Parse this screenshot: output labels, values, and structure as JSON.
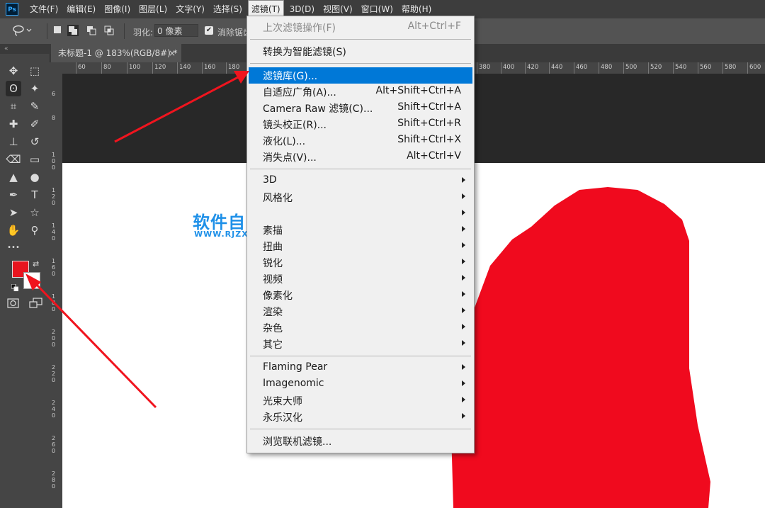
{
  "app": {
    "logo_text": "Ps"
  },
  "menubar": {
    "items": [
      {
        "label": "文件(F)"
      },
      {
        "label": "编辑(E)"
      },
      {
        "label": "图像(I)"
      },
      {
        "label": "图层(L)"
      },
      {
        "label": "文字(Y)"
      },
      {
        "label": "选择(S)"
      },
      {
        "label": "滤镜(T)"
      },
      {
        "label": "3D(D)"
      },
      {
        "label": "视图(V)"
      },
      {
        "label": "窗口(W)"
      },
      {
        "label": "帮助(H)"
      }
    ],
    "active_index": 6
  },
  "options": {
    "feather_label": "羽化:",
    "feather_value": "0 像素",
    "antialias_label": "消除锯齿",
    "antialias_checked": "✔"
  },
  "document_tab": {
    "title": "未标题-1 @ 183%(RGB/8#) *",
    "close": "×"
  },
  "ruler_top_labels": [
    "60",
    "80",
    "100",
    "120",
    "140",
    "160",
    "180",
    "380",
    "400",
    "420",
    "440",
    "460",
    "480",
    "500",
    "520",
    "540",
    "560",
    "580",
    "600"
  ],
  "ruler_left_labels": [
    "6",
    "8",
    "1 0 0",
    "1 2 0",
    "1 4 0",
    "1 6 0",
    "1 8 0",
    "2 0 0",
    "2 2 0",
    "2 4 0",
    "2 6 0",
    "2 8 0"
  ],
  "toolbar": {
    "handle": "«",
    "tools": [
      {
        "name": "move-tool",
        "glyph": "✥"
      },
      {
        "name": "marquee-tool",
        "glyph": "⬚"
      },
      {
        "name": "lasso-tool",
        "glyph": "ʘ"
      },
      {
        "name": "magic-wand-tool",
        "glyph": "✦"
      },
      {
        "name": "crop-tool",
        "glyph": "⌗"
      },
      {
        "name": "eyedropper-tool",
        "glyph": "✎"
      },
      {
        "name": "healing-brush-tool",
        "glyph": "✚"
      },
      {
        "name": "brush-tool",
        "glyph": "✐"
      },
      {
        "name": "stamp-tool",
        "glyph": "⊥"
      },
      {
        "name": "history-brush-tool",
        "glyph": "↺"
      },
      {
        "name": "eraser-tool",
        "glyph": "⌫"
      },
      {
        "name": "gradient-tool",
        "glyph": "▭"
      },
      {
        "name": "blur-tool",
        "glyph": "▲"
      },
      {
        "name": "dodge-tool",
        "glyph": "●"
      },
      {
        "name": "pen-tool",
        "glyph": "✒"
      },
      {
        "name": "type-tool",
        "glyph": "T"
      },
      {
        "name": "path-selection-tool",
        "glyph": "➤"
      },
      {
        "name": "shape-tool",
        "glyph": "☆"
      },
      {
        "name": "hand-tool",
        "glyph": "✋"
      },
      {
        "name": "zoom-tool",
        "glyph": "⚲"
      },
      {
        "name": "more-tools",
        "glyph": "•••"
      }
    ]
  },
  "watermark": {
    "title": "软件自学网",
    "url": "WWW.RJZXW.COM"
  },
  "filter_menu": {
    "items": [
      {
        "label": "上次滤镜操作(F)",
        "shortcut": "Alt+Ctrl+F",
        "disabled": true
      },
      {
        "sep": true
      },
      {
        "label": "转换为智能滤镜(S)",
        "shortcut": ""
      },
      {
        "sep": true
      },
      {
        "label": "滤镜库(G)...",
        "shortcut": "",
        "highlighted": true
      },
      {
        "label": "自适应广角(A)...",
        "shortcut": "Alt+Shift+Ctrl+A"
      },
      {
        "label": "Camera Raw 滤镜(C)...",
        "shortcut": "Shift+Ctrl+A"
      },
      {
        "label": "镜头校正(R)...",
        "shortcut": "Shift+Ctrl+R"
      },
      {
        "label": "液化(L)...",
        "shortcut": "Shift+Ctrl+X"
      },
      {
        "label": "消失点(V)...",
        "shortcut": "Alt+Ctrl+V"
      },
      {
        "sep": true
      },
      {
        "label": "3D",
        "submenu": true
      },
      {
        "label": "风格化",
        "submenu": true
      },
      {
        "label": "",
        "submenu": true
      },
      {
        "label": "素描",
        "submenu": true
      },
      {
        "label": "扭曲",
        "submenu": true
      },
      {
        "label": "锐化",
        "submenu": true
      },
      {
        "label": "视频",
        "submenu": true
      },
      {
        "label": "像素化",
        "submenu": true
      },
      {
        "label": "渲染",
        "submenu": true
      },
      {
        "label": "杂色",
        "submenu": true
      },
      {
        "label": "其它",
        "submenu": true
      },
      {
        "sep": true
      },
      {
        "label": "Flaming Pear",
        "submenu": true
      },
      {
        "label": "Imagenomic",
        "submenu": true
      },
      {
        "label": "光束大师",
        "submenu": true
      },
      {
        "label": "永乐汉化",
        "submenu": true
      },
      {
        "sep": true
      },
      {
        "label": "浏览联机滤镜..."
      }
    ]
  },
  "colors": {
    "foreground": "#e8141e",
    "background": "#ffffff",
    "red_shape": "#f00a1e",
    "annotation_arrow": "#f0141e",
    "menu_highlight": "#0078d7"
  }
}
